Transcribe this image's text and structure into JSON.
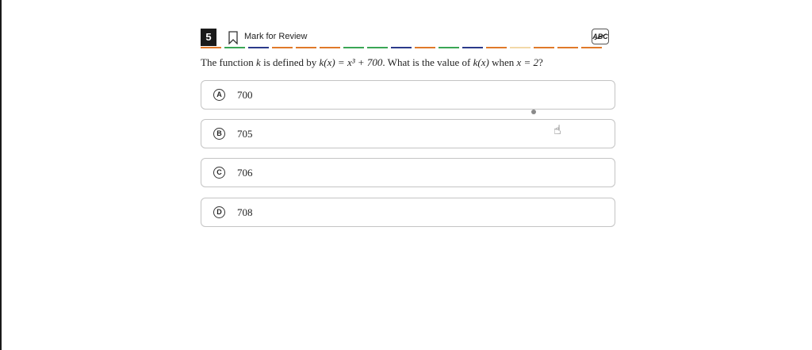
{
  "question_header": {
    "number": "5",
    "mark_for_review_label": "Mark for Review",
    "abc_label": "ABC"
  },
  "dash_colors": [
    "#e07a2a",
    "#3aa655",
    "#2b3a8a",
    "#e07a2a",
    "#e07a2a",
    "#e07a2a",
    "#3aa655",
    "#3aa655",
    "#2b3a8a",
    "#e07a2a",
    "#3aa655",
    "#2b3a8a",
    "#e07a2a",
    "#f2d8a8",
    "#e07a2a",
    "#e07a2a",
    "#e07a2a"
  ],
  "question": {
    "p1": "The function ",
    "v1": "k",
    "p2": " is defined by ",
    "f1": "k(x) = x³ + 700",
    "p3": ". What is the value of ",
    "f2": "k(x)",
    "p4": " when ",
    "f3": "x = 2",
    "p5": "?"
  },
  "options": [
    {
      "letter": "A",
      "text": "700"
    },
    {
      "letter": "B",
      "text": "705"
    },
    {
      "letter": "C",
      "text": "706"
    },
    {
      "letter": "D",
      "text": "708"
    }
  ]
}
